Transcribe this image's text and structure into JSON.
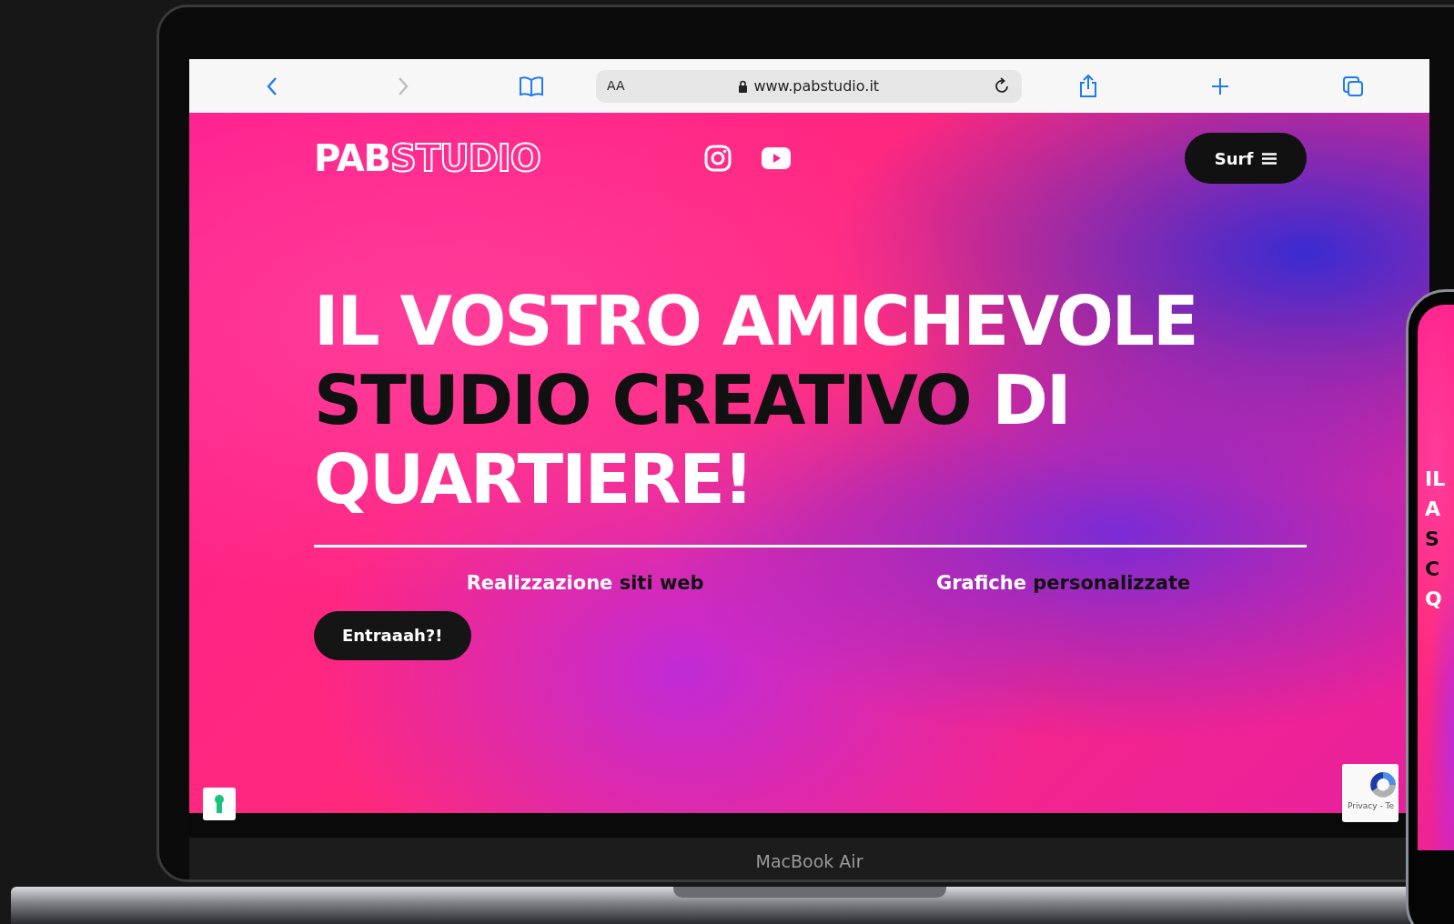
{
  "browser": {
    "text_size_label": "AA",
    "url": "www.pabstudio.it"
  },
  "site": {
    "logo": [
      {
        "text": "PAB",
        "kind": "solid"
      },
      {
        "text": "STUDIO",
        "kind": "outline"
      }
    ],
    "menu_button": "Surf",
    "headline": [
      [
        {
          "text": "IL VOSTRO AMICHEVOLE",
          "kind": "light"
        }
      ],
      [
        {
          "text": "STUDIO CREATIVO ",
          "kind": "dark"
        },
        {
          "text": "DI",
          "kind": "light"
        }
      ],
      [
        {
          "text": "QUARTIERE!",
          "kind": "light"
        }
      ]
    ],
    "services": [
      [
        {
          "text": "Realizzazione ",
          "kind": "light"
        },
        {
          "text": "siti web",
          "kind": "dark"
        }
      ],
      [
        {
          "text": "Grafiche ",
          "kind": "light"
        },
        {
          "text": "personalizzate",
          "kind": "dark"
        }
      ]
    ],
    "cta": "Entraaah?!"
  },
  "recaptcha": {
    "text": "Privacy - Te"
  },
  "device_label": "MacBook Air",
  "phone": {
    "headline": [
      {
        "text": "IL",
        "kind": "light"
      },
      {
        "text": "A",
        "kind": "light"
      },
      {
        "text": "S",
        "kind": "dark"
      },
      {
        "text": "C",
        "kind": "dark"
      },
      {
        "text": "Q",
        "kind": "light"
      }
    ]
  }
}
